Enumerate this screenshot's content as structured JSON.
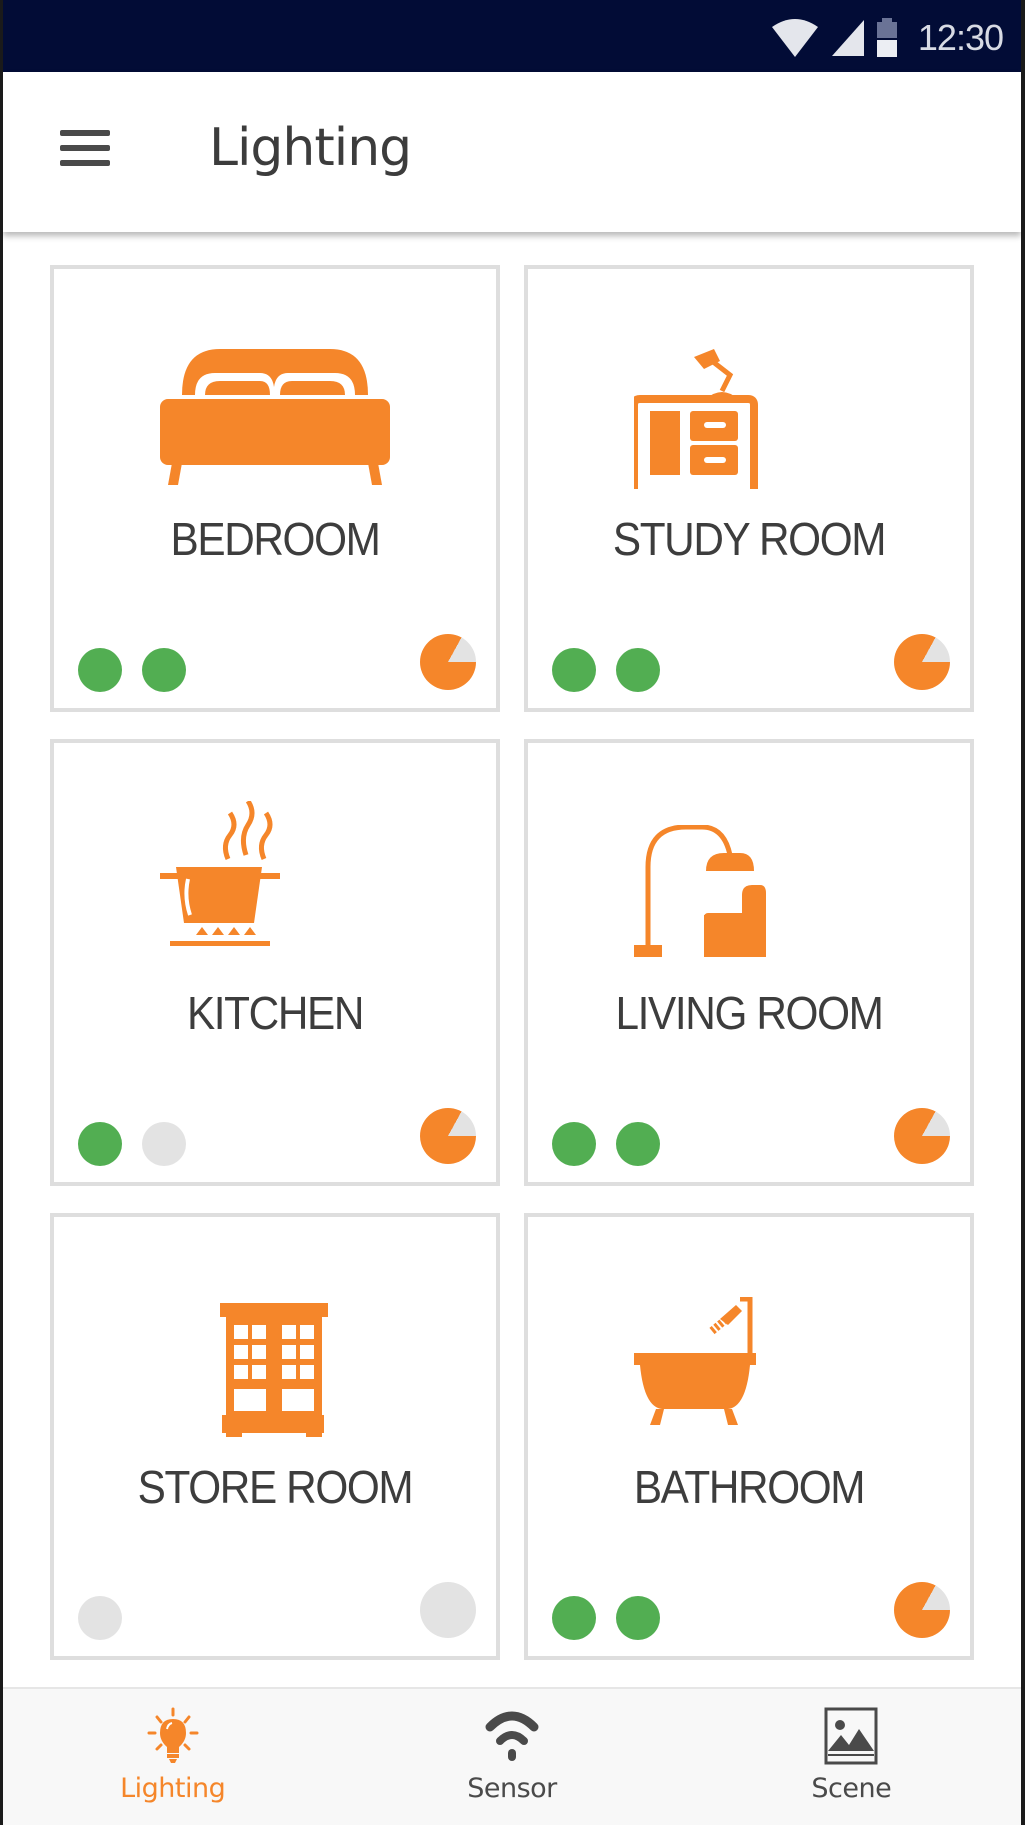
{
  "status_bar": {
    "time": "12:30",
    "icons": [
      "wifi-icon",
      "cell-signal-icon",
      "battery-icon"
    ]
  },
  "app_bar": {
    "menu_icon": "hamburger-menu-icon",
    "title": "Lighting"
  },
  "colors": {
    "accent": "#f5862a",
    "status_bar_bg": "#020c36",
    "light_on": "#52ae52",
    "light_off": "#e3e3e3",
    "card_border": "#dedede",
    "text": "#3d3d3d"
  },
  "rooms": [
    {
      "name": "BEDROOM",
      "icon": "bed-icon",
      "lights": [
        "on",
        "on"
      ],
      "brightness_percent": 83,
      "active": true
    },
    {
      "name": "STUDY ROOM",
      "icon": "desk-lamp-icon",
      "lights": [
        "on",
        "on"
      ],
      "brightness_percent": 83,
      "active": true
    },
    {
      "name": "KITCHEN",
      "icon": "cooking-pot-icon",
      "lights": [
        "on",
        "off"
      ],
      "brightness_percent": 83,
      "active": true
    },
    {
      "name": "LIVING ROOM",
      "icon": "floor-lamp-armchair-icon",
      "lights": [
        "on",
        "on"
      ],
      "brightness_percent": 83,
      "active": true
    },
    {
      "name": "STORE ROOM",
      "icon": "cabinet-icon",
      "lights": [
        "off"
      ],
      "brightness_percent": 0,
      "active": false
    },
    {
      "name": "BATHROOM",
      "icon": "bathtub-icon",
      "lights": [
        "on",
        "on"
      ],
      "brightness_percent": 83,
      "active": true
    }
  ],
  "bottom_nav": {
    "items": [
      {
        "label": "Lighting",
        "icon": "lightbulb-icon",
        "active": true
      },
      {
        "label": "Sensor",
        "icon": "wifi-signal-icon",
        "active": false
      },
      {
        "label": "Scene",
        "icon": "image-icon",
        "active": false
      }
    ]
  }
}
